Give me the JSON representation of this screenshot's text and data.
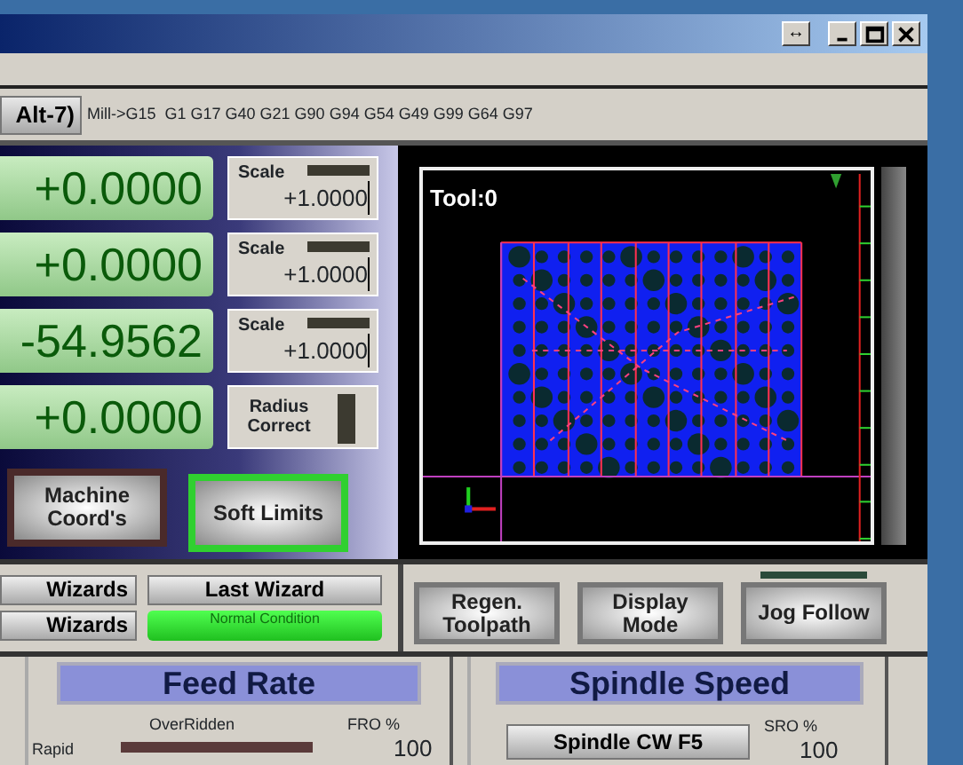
{
  "title_bar": {
    "extra_button": "↔"
  },
  "gcode_bar": {
    "button": "Alt-7)",
    "modal_codes": "Mill->G15  G1 G17 G40 G21 G90 G94 G54 G49 G99 G64 G97"
  },
  "dro": [
    {
      "value": "+0.0000",
      "scale_label": "Scale",
      "scale": "+1.0000",
      "scale_led": false
    },
    {
      "value": "+0.0000",
      "scale_label": "Scale",
      "scale": "+1.0000",
      "scale_led": false
    },
    {
      "value": "-54.9562",
      "scale_label": "Scale",
      "scale": "+1.0000",
      "scale_led": false
    },
    {
      "value": "+0.0000"
    }
  ],
  "radius_correct": {
    "label": "Radius Correct",
    "on": false
  },
  "mode_buttons": [
    {
      "label": "Machine Coord's",
      "active": false
    },
    {
      "label": "Soft Limits",
      "active": true
    }
  ],
  "toolpath": {
    "label": "Tool:0"
  },
  "toolpath_buttons": [
    {
      "label": "Regen. Toolpath"
    },
    {
      "label": "Display Mode"
    },
    {
      "label": "Jog Follow",
      "led": false
    }
  ],
  "wizards": {
    "buttons": [
      "Wizards",
      "Wizards"
    ],
    "last_wizard": "Last Wizard",
    "status": "Normal Condition"
  },
  "feed_rate": {
    "title": "Feed Rate",
    "overridden_label": "OverRidden",
    "overridden": false,
    "fro_label": "FRO %",
    "rapid_label": "Rapid",
    "fro_value": "100"
  },
  "spindle": {
    "title": "Spindle Speed",
    "button": "Spindle CW F5",
    "sro_label": "SRO %",
    "sro_value": "100"
  }
}
